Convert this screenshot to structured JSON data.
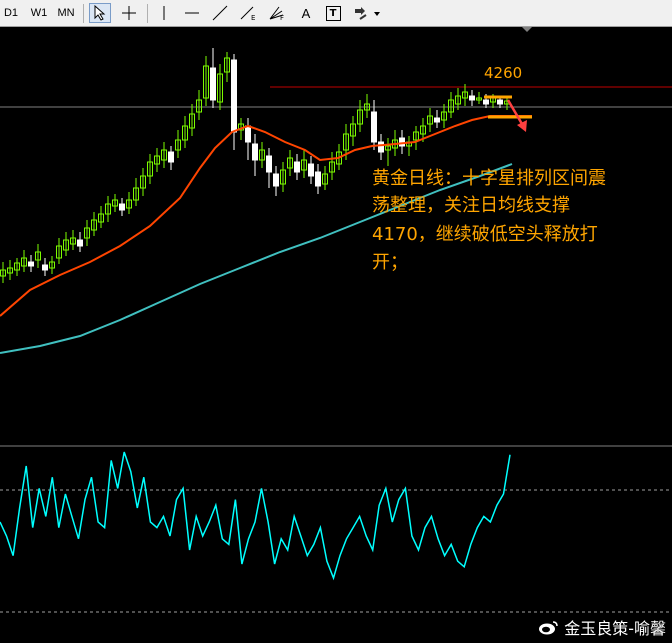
{
  "toolbar": {
    "timeframes": [
      "D1",
      "W1",
      "MN"
    ],
    "tools": [
      "cursor-icon",
      "crosshair-icon",
      "vertical-line-icon",
      "horizontal-line-icon",
      "trendline-icon",
      "fibonacci-icon",
      "gann-fan-icon",
      "text-icon",
      "text-label-icon",
      "arrows-icon"
    ],
    "text_tool_label": "A",
    "text_label_tool_label": "T"
  },
  "chart": {
    "price_label": "4260",
    "annotation_lines": [
      "黄金日线：十字星排列区间震",
      "荡整理，关注日均线支撑",
      "4170，继续破低空头释放打",
      "开；"
    ],
    "colors": {
      "background": "#000000",
      "bull_candle": "#7cfc00",
      "bear_candle": "#ffffff",
      "ma_short": "#ff4500",
      "ma_long": "#40c0c0",
      "resistance_line": "#c00000",
      "indicator": "#00ffff",
      "annotation": "#ffa500",
      "arrow": "#ff4040"
    }
  },
  "indicator": {
    "values": [
      50,
      45,
      38,
      55,
      70,
      48,
      62,
      52,
      66,
      48,
      60,
      52,
      44,
      58,
      66,
      50,
      48,
      72,
      62,
      75,
      68,
      55,
      66,
      50,
      48,
      52,
      45,
      58,
      62,
      40,
      52,
      45,
      50,
      56,
      44,
      42,
      58,
      35,
      44,
      50,
      62,
      50,
      35,
      44,
      40,
      52,
      45,
      38,
      42,
      48,
      36,
      30,
      38,
      44,
      48,
      52,
      45,
      40,
      56,
      62,
      50,
      58,
      62,
      45,
      40,
      48,
      52,
      44,
      38,
      42,
      36,
      34,
      42,
      48,
      52,
      50,
      56,
      60,
      74
    ]
  },
  "watermark": {
    "text": "金玉良策-喻馨"
  }
}
